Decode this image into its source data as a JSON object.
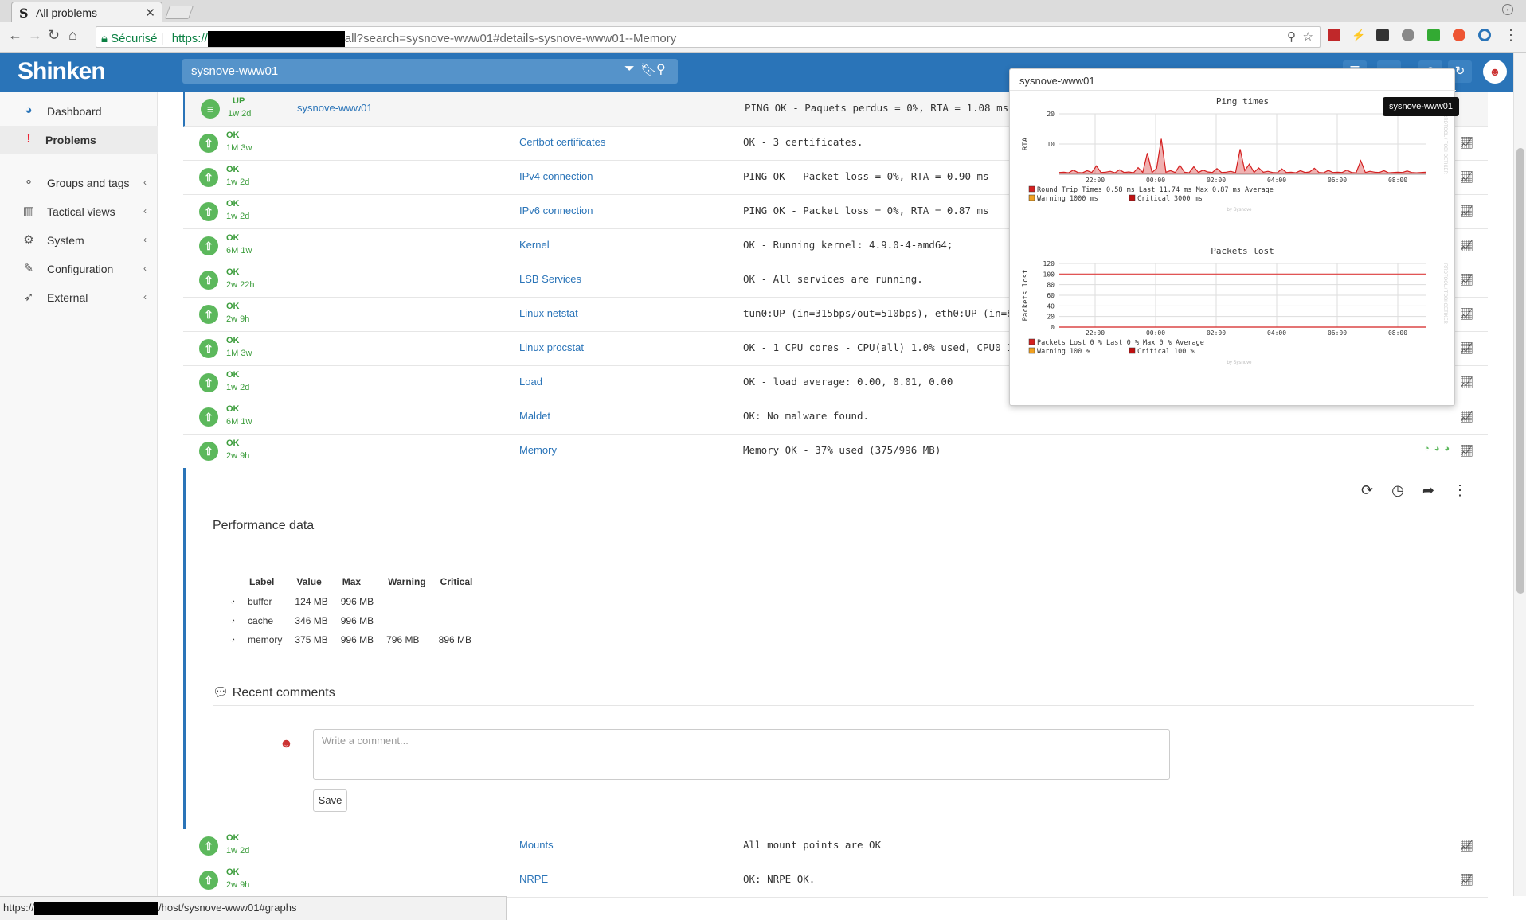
{
  "browser": {
    "tab_title": "All problems",
    "tab_favicon": "S",
    "secure_label": "Sécurisé",
    "url_scheme": "https://",
    "url_rest": "all?search=sysnove-www01#details-sysnove-www01--Memory"
  },
  "header": {
    "logo": "Shinken",
    "search_value": "sysnove-www01",
    "color": "#2a74b8"
  },
  "sidebar": {
    "items": [
      {
        "label": "Dashboard",
        "icon": "dashboard-icon",
        "glyph": "◕"
      },
      {
        "label": "Problems",
        "icon": "alert-icon",
        "glyph": "!"
      },
      {
        "label": "Groups and tags",
        "icon": "sitemap-icon",
        "glyph": "⚬"
      },
      {
        "label": "Tactical views",
        "icon": "bar-chart-icon",
        "glyph": "▥"
      },
      {
        "label": "System",
        "icon": "gears-icon",
        "glyph": "⚙"
      },
      {
        "label": "Configuration",
        "icon": "wrench-icon",
        "glyph": "✎"
      },
      {
        "label": "External",
        "icon": "rocket-icon",
        "glyph": "➶"
      }
    ],
    "chevron": "‹"
  },
  "host_row": {
    "state": "UP",
    "duration": "1w 2d",
    "name": "sysnove-www01",
    "output": "PING OK - Paquets perdus = 0%, RTA = 1.08 ms"
  },
  "services": [
    {
      "state": "OK",
      "duration": "1M 3w",
      "name": "Certbot certificates",
      "output": "OK - 3 certificates."
    },
    {
      "state": "OK",
      "duration": "1w 2d",
      "name": "IPv4 connection",
      "output": "PING OK - Packet loss = 0%, RTA = 0.90 ms"
    },
    {
      "state": "OK",
      "duration": "1w 2d",
      "name": "IPv6 connection",
      "output": "PING OK - Packet loss = 0%, RTA = 0.87 ms"
    },
    {
      "state": "OK",
      "duration": "6M 1w",
      "name": "Kernel",
      "output": "OK - Running kernel: 4.9.0-4-amd64;"
    },
    {
      "state": "OK",
      "duration": "2w 22h",
      "name": "LSB Services",
      "output": "OK - All services are running."
    },
    {
      "state": "OK",
      "duration": "2w 9h",
      "name": "Linux netstat",
      "output": "tun0:UP (in=315bps/out=510bps), eth0:UP (in=8k"
    },
    {
      "state": "OK",
      "duration": "1M 3w",
      "name": "Linux procstat",
      "output": "OK - 1 CPU cores - CPU(all) 1.0% used, CPU0 1.0"
    },
    {
      "state": "OK",
      "duration": "1w 2d",
      "name": "Load",
      "output": "OK - load average: 0.00, 0.01, 0.00"
    },
    {
      "state": "OK",
      "duration": "6M 1w",
      "name": "Maldet",
      "output": "OK: No malware found."
    },
    {
      "state": "OK",
      "duration": "2w 9h",
      "name": "Memory",
      "output": "Memory OK - 37% used (375/996 MB)"
    }
  ],
  "services_after": [
    {
      "state": "OK",
      "duration": "1w 2d",
      "name": "Mounts",
      "output": "All mount points are OK"
    },
    {
      "state": "OK",
      "duration": "2w 9h",
      "name": "NRPE",
      "output": "OK: NRPE OK."
    }
  ],
  "detail": {
    "perf_title": "Performance data",
    "perf_headers": [
      "Label",
      "Value",
      "Max",
      "Warning",
      "Critical"
    ],
    "perf_rows": [
      {
        "label": "buffer",
        "value": "124 MB",
        "max": "996 MB",
        "warning": "",
        "critical": ""
      },
      {
        "label": "cache",
        "value": "346 MB",
        "max": "996 MB",
        "warning": "",
        "critical": ""
      },
      {
        "label": "memory",
        "value": "375 MB",
        "max": "996 MB",
        "warning": "796 MB",
        "critical": "896 MB"
      }
    ],
    "comments_title": "Recent comments",
    "comment_placeholder": "Write a comment...",
    "save_label": "Save"
  },
  "popup": {
    "title": "sysnove-www01",
    "tooltip": "sysnove-www01"
  },
  "chart_data": [
    {
      "type": "line",
      "title": "Ping times",
      "ylabel": "RTA",
      "ylim": [
        0,
        20
      ],
      "yticks": [
        "20",
        "10"
      ],
      "xticks": [
        "22:00",
        "00:00",
        "02:00",
        "04:00",
        "06:00",
        "08:00"
      ],
      "legend": [
        "Round Trip Times    0.58 ms Last   11.74 ms Max    0.87 ms Average",
        "Warning 1000 ms",
        "Critical 3000 ms"
      ],
      "credit": "by Sysnove",
      "side_text": "RRDTOOL / TOBI OETIKER",
      "series": [
        {
          "name": "Round Trip Times",
          "color": "#d42020",
          "values": [
            0.6,
            0.7,
            0.5,
            1.4,
            0.6,
            0.5,
            1.2,
            0.6,
            2.8,
            0.6,
            0.7,
            1.0,
            0.5,
            1.5,
            0.6,
            0.8,
            0.5,
            2.2,
            0.6,
            7.0,
            0.6,
            2.0,
            11.7,
            0.7,
            1.2,
            0.6,
            3.0,
            0.7,
            0.5,
            2.5,
            0.6,
            1.4,
            0.8,
            0.6,
            1.9,
            0.6,
            0.7,
            1.0,
            0.5,
            8.3,
            1.2,
            3.4,
            0.6,
            2.1,
            0.7,
            1.0,
            0.6,
            0.5,
            1.8,
            0.6,
            0.7,
            0.5,
            1.2,
            0.6,
            0.8,
            2.0,
            0.6,
            0.5,
            1.3,
            0.6,
            0.7,
            0.6,
            1.4,
            0.6,
            0.5,
            4.5,
            0.6,
            1.0,
            0.7,
            0.6,
            1.2,
            0.5,
            0.6,
            0.7,
            0.6,
            1.1,
            0.6,
            0.5,
            0.6,
            0.7
          ]
        }
      ]
    },
    {
      "type": "line",
      "title": "Packets lost",
      "ylabel": "Packets lost",
      "ylim": [
        0,
        120
      ],
      "yticks": [
        "120",
        "100",
        "80",
        "60",
        "40",
        "20",
        "0"
      ],
      "xticks": [
        "22:00",
        "00:00",
        "02:00",
        "04:00",
        "06:00",
        "08:00"
      ],
      "legend": [
        "Packets Lost     0 % Last     0 % Max     0 % Average",
        "Warning  100 %",
        "Critical 100 %"
      ],
      "credit": "by Sysnove",
      "side_text": "RRDTOOL / TOBI OETIKER",
      "thresholds": [
        100
      ],
      "series": [
        {
          "name": "Packets Lost",
          "color": "#d42020",
          "values": [
            0,
            0,
            0,
            0,
            0,
            0,
            0,
            0,
            0,
            0
          ]
        }
      ]
    }
  ],
  "statusbar": {
    "prefix": "https://",
    "suffix": "/host/sysnove-www01#graphs"
  },
  "colors": {
    "ok": "#5cb85c",
    "link": "#2a74b8",
    "danger": "#d42020"
  }
}
